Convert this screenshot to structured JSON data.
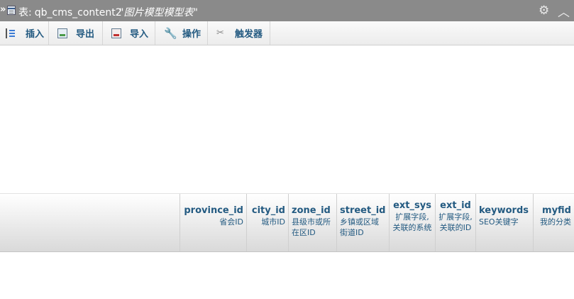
{
  "title_bar": {
    "arrow": "»",
    "table_label": "表:",
    "table_name": "qb_cms_content2",
    "table_comment": "\"图片模型模型表\"",
    "gear_icon": "gear-icon",
    "collapse_icon": "collapse-icon"
  },
  "toolbar": {
    "items": [
      {
        "label": "插入",
        "icon": "insert-icon"
      },
      {
        "label": "导出",
        "icon": "export-icon"
      },
      {
        "label": "导入",
        "icon": "import-icon"
      },
      {
        "label": "操作",
        "icon": "wrench-icon"
      },
      {
        "label": "触发器",
        "icon": "trigger-icon"
      }
    ]
  },
  "columns": [
    {
      "name": "province_id",
      "comment": "省会ID"
    },
    {
      "name": "city_id",
      "comment": "城市ID"
    },
    {
      "name": "zone_id",
      "comment": "县级市或所在区ID"
    },
    {
      "name": "street_id",
      "comment": "乡镇或区域街道ID"
    },
    {
      "name": "ext_sys",
      "comment": "扩展字段,关联的系统"
    },
    {
      "name": "ext_id",
      "comment": "扩展字段,关联的ID"
    },
    {
      "name": "keywords",
      "comment": "SEO关键字"
    },
    {
      "name": "myfid",
      "comment": "我的分类"
    }
  ]
}
